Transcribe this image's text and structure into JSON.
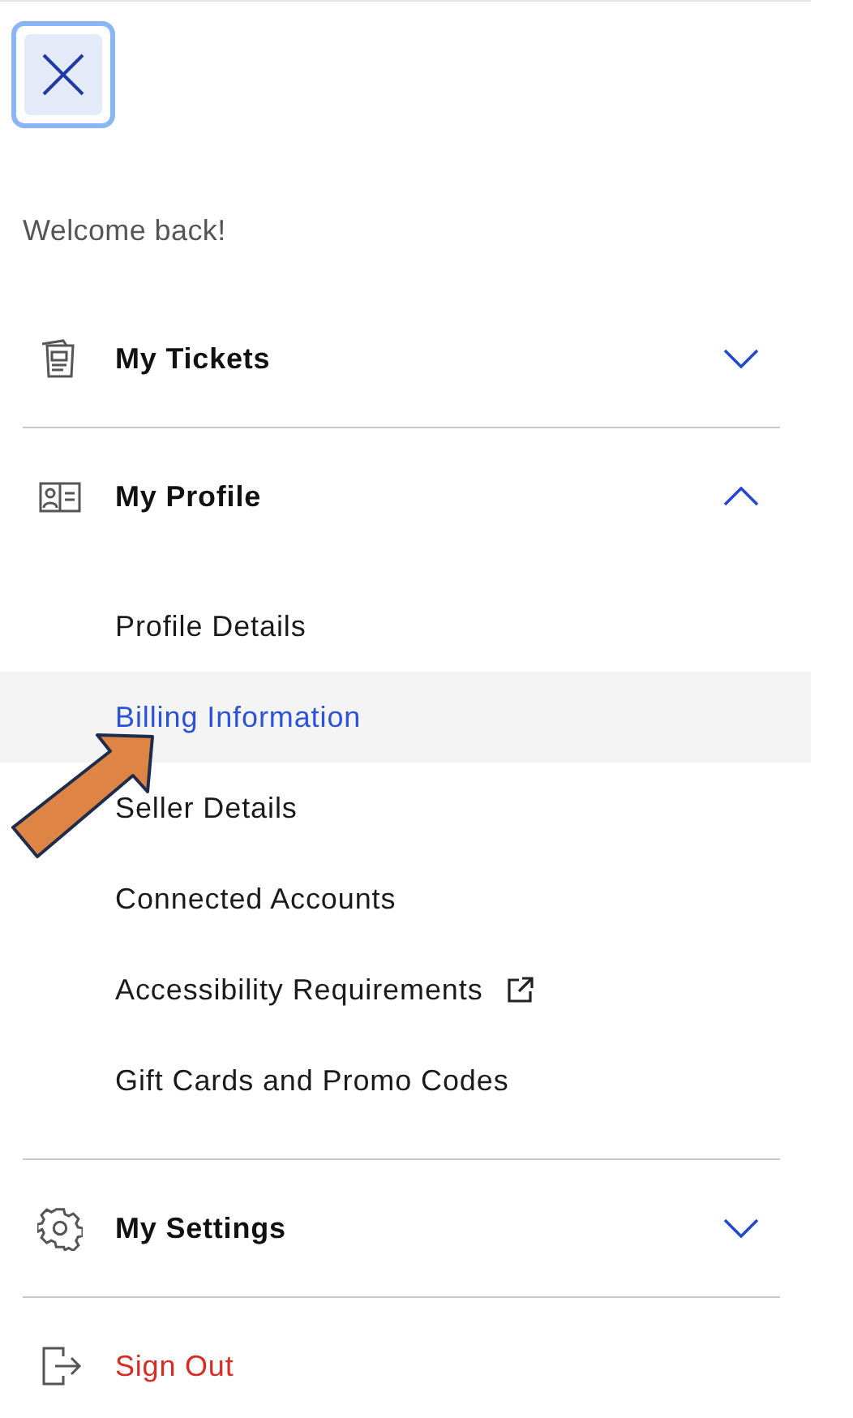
{
  "close_button": {
    "selected": true
  },
  "greeting": "Welcome back!",
  "menu": [
    {
      "kind": "tickets",
      "label": "My Tickets",
      "expanded": false
    },
    {
      "kind": "profile",
      "label": "My Profile",
      "expanded": true,
      "children": [
        {
          "label": "Profile Details",
          "selected": false,
          "external": false
        },
        {
          "label": "Billing Information",
          "selected": true,
          "external": false
        },
        {
          "label": "Seller Details",
          "selected": false,
          "external": false
        },
        {
          "label": "Connected Accounts",
          "selected": false,
          "external": false
        },
        {
          "label": "Accessibility Requirements",
          "selected": false,
          "external": true
        },
        {
          "label": "Gift Cards and Promo Codes",
          "selected": false,
          "external": false
        }
      ]
    },
    {
      "kind": "settings",
      "label": "My Settings",
      "expanded": false
    },
    {
      "kind": "signout",
      "label": "Sign Out"
    }
  ],
  "annotation": {
    "kind": "arrow"
  }
}
